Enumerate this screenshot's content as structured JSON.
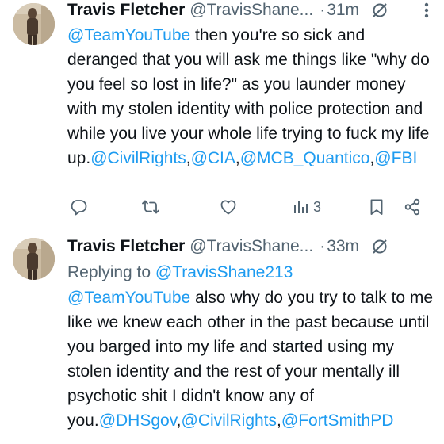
{
  "tweets": [
    {
      "author_name": "Travis Fletcher",
      "author_handle": "@TravisShane...",
      "dot": "·",
      "time": "31m",
      "segments": [
        {
          "t": "@TeamYouTube",
          "mention": true
        },
        {
          "t": " then you're so sick and deranged that you will ask me things like \"why do you feel so lost in life?\" as you launder money with my stolen identity with police protection and while you live your whole life trying to fuck my life up.",
          "mention": false
        },
        {
          "t": "@CivilRights",
          "mention": true
        },
        {
          "t": ",",
          "mention": false
        },
        {
          "t": "@CIA",
          "mention": true
        },
        {
          "t": ",",
          "mention": false
        },
        {
          "t": "@MCB_Quantico",
          "mention": true
        },
        {
          "t": ",",
          "mention": false
        },
        {
          "t": "@FBI",
          "mention": true
        }
      ],
      "actions": {
        "reply_icon": "reply-icon",
        "repost_icon": "repost-icon",
        "like_icon": "like-icon",
        "views_icon": "views-icon",
        "views_count": "3",
        "bookmark_icon": "bookmark-icon",
        "share_icon": "share-icon"
      }
    },
    {
      "author_name": "Travis Fletcher",
      "author_handle": "@TravisShane...",
      "dot": "·",
      "time": "33m",
      "replying_prefix": "Replying to ",
      "replying_to": "@TravisShane213",
      "segments": [
        {
          "t": "@TeamYouTube",
          "mention": true
        },
        {
          "t": " also why do you try to talk to me like we knew each other in the past because until you barged into my life and started using my stolen identity and the rest of your mentally ill psychotic shit I didn't know any of you.",
          "mention": false
        },
        {
          "t": "@DHSgov",
          "mention": true
        },
        {
          "t": ",",
          "mention": false
        },
        {
          "t": "@CivilRights",
          "mention": true
        },
        {
          "t": ",",
          "mention": false
        },
        {
          "t": "@FortSmithPD",
          "mention": true
        }
      ]
    }
  ],
  "colors": {
    "text": "#0f1419",
    "secondary": "#536471",
    "link": "#1d9bf0",
    "divider": "#d5dce1"
  }
}
